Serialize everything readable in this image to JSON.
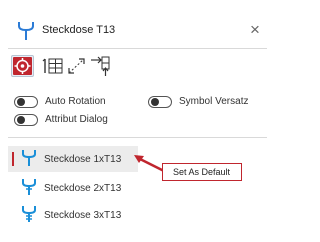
{
  "header": {
    "title": "Steckdose T13",
    "icon": "socket-symbol-icon",
    "close_label": "×"
  },
  "toolbar": {
    "tools": [
      {
        "icon": "target-crosshair-icon",
        "active": true
      },
      {
        "icon": "grid-number-icon"
      },
      {
        "icon": "diagonal-arrows-icon"
      },
      {
        "icon": "move-insert-icon"
      }
    ]
  },
  "toggles": {
    "auto_rotation": {
      "label": "Auto Rotation",
      "on": false
    },
    "symbol_versatz": {
      "label": "Symbol Versatz",
      "on": false
    },
    "attribut_dialog": {
      "label": "Attribut Dialog",
      "on": false
    }
  },
  "symbols": {
    "items": [
      {
        "label": "Steckdose 1xT13",
        "selected": true
      },
      {
        "label": "Steckdose 2xT13",
        "selected": false
      },
      {
        "label": "Steckdose 3xT13",
        "selected": false
      }
    ]
  },
  "tooltip": {
    "text": "Set As Default"
  },
  "colors": {
    "accent_red": "#c0262e",
    "icon_blue": "#1a8fd8",
    "header_icon_blue": "#2b7bd6"
  }
}
